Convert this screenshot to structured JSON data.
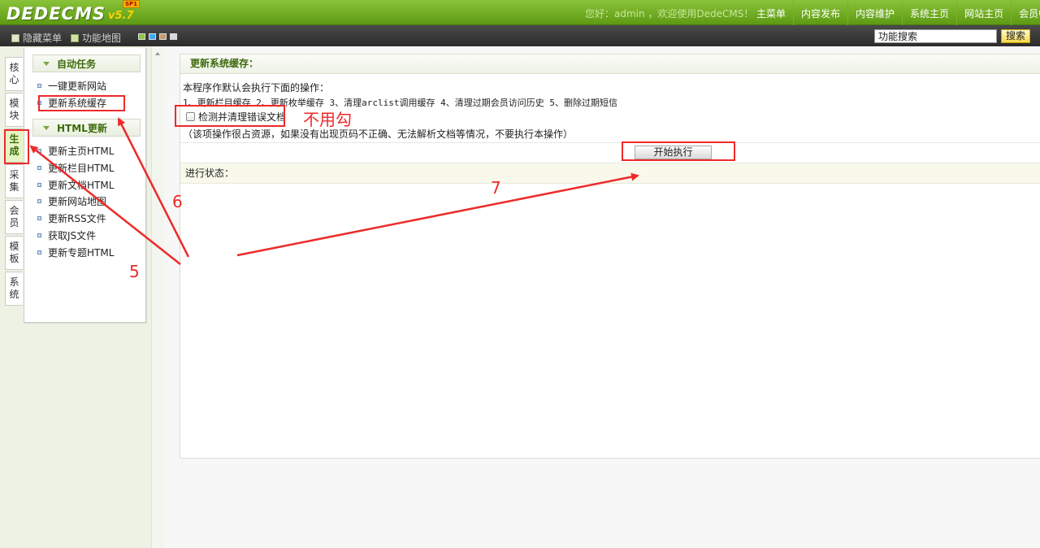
{
  "header": {
    "logo": "DEDECMS",
    "version": "v5.7",
    "edition": "SP1",
    "greeting": "您好：admin ，欢迎使用DedeCMS！",
    "nav": [
      "主菜单",
      "内容发布",
      "内容维护",
      "系统主页",
      "网站主页",
      "会员中"
    ]
  },
  "toolbar": {
    "hide_menu": "隐藏菜单",
    "function_map": "功能地图",
    "skin_colors": [
      "#8dc63f",
      "#3fa9f5",
      "#c49a6c",
      "#d9d9d9"
    ],
    "search_value": "功能搜索",
    "search_button": "搜索"
  },
  "vtabs": [
    {
      "label": "核心"
    },
    {
      "label": "模块"
    },
    {
      "label": "生成",
      "active": true
    },
    {
      "label": "采集"
    },
    {
      "label": "会员"
    },
    {
      "label": "模板"
    },
    {
      "label": "系统"
    }
  ],
  "menu": {
    "group1": {
      "title": "自动任务",
      "items": [
        "一键更新网站",
        "更新系统缓存"
      ]
    },
    "group2": {
      "title": "HTML更新",
      "items": [
        "更新主页HTML",
        "更新栏目HTML",
        "更新文档HTML",
        "更新网站地图",
        "更新RSS文件",
        "获取JS文件",
        "更新专题HTML"
      ]
    }
  },
  "panel": {
    "title": "更新系统缓存：",
    "intro": "本程序作默认会执行下面的操作：",
    "operations": "1、更新栏目缓存 2、更新枚举缓存 3、清理arclist调用缓存 4、清理过期会员访问历史 5、删除过期短信",
    "checkbox_label": "检测并清理错误文档",
    "checkbox_checked": false,
    "note": "（该项操作很占资源，如果没有出现页码不正确、无法解析文档等情况，不要执行本操作）",
    "start_button": "开始执行",
    "status_label": "进行状态："
  },
  "annotations": {
    "no_check": "不用勾",
    "step5": "5",
    "step6": "6",
    "step7": "7",
    "color": "#ee2a2a"
  }
}
